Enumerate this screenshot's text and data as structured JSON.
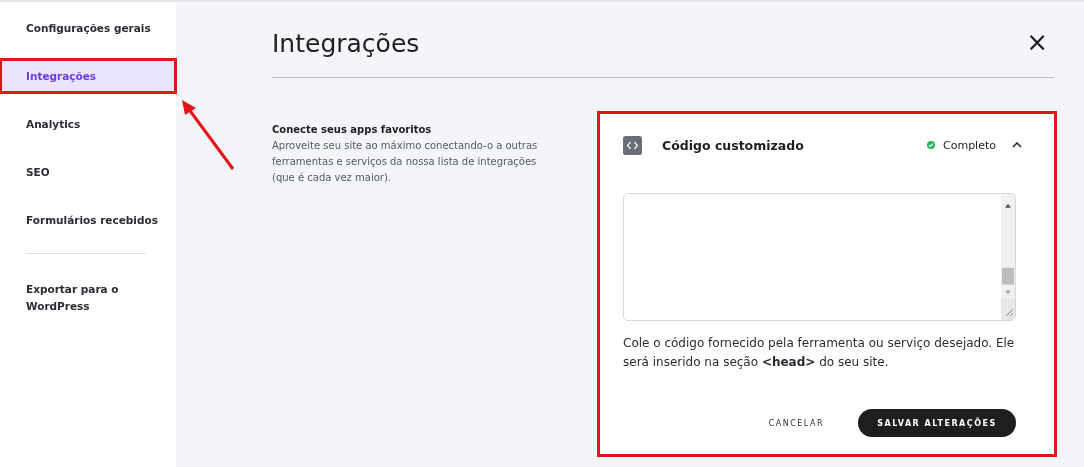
{
  "sidebar": {
    "items": [
      {
        "label": "Configurações gerais",
        "selected": false,
        "highlighted": false
      },
      {
        "label": "Integrações",
        "selected": true,
        "highlighted": true
      },
      {
        "label": "Analytics",
        "selected": false,
        "highlighted": false
      },
      {
        "label": "SEO",
        "selected": false,
        "highlighted": false
      },
      {
        "label": "Formulários recebidos",
        "selected": false,
        "highlighted": false
      }
    ],
    "footer_items": [
      {
        "label": "Exportar para o WordPress",
        "selected": false
      }
    ]
  },
  "page": {
    "title": "Integrações",
    "close": "×"
  },
  "intro": {
    "heading": "Conecte seus apps favoritos",
    "text": "Aproveite seu site ao máximo conectando-o a outras ferramentas e serviços da nossa lista de integrações (que é cada vez maior)."
  },
  "card": {
    "title": "Código customizado",
    "status": {
      "label": "Completo",
      "color": "#1db954"
    },
    "expanded": true,
    "highlighted": true,
    "help": "Cole o código fornecido pela ferramenta ou serviço desejado. Ele será inserido na seção **<head>** do seu site.",
    "buttons": [
      {
        "label": "CANCELAR",
        "kind": "secondary"
      },
      {
        "label": "SALVAR ALTERAÇÕES",
        "kind": "primary"
      }
    ]
  }
}
